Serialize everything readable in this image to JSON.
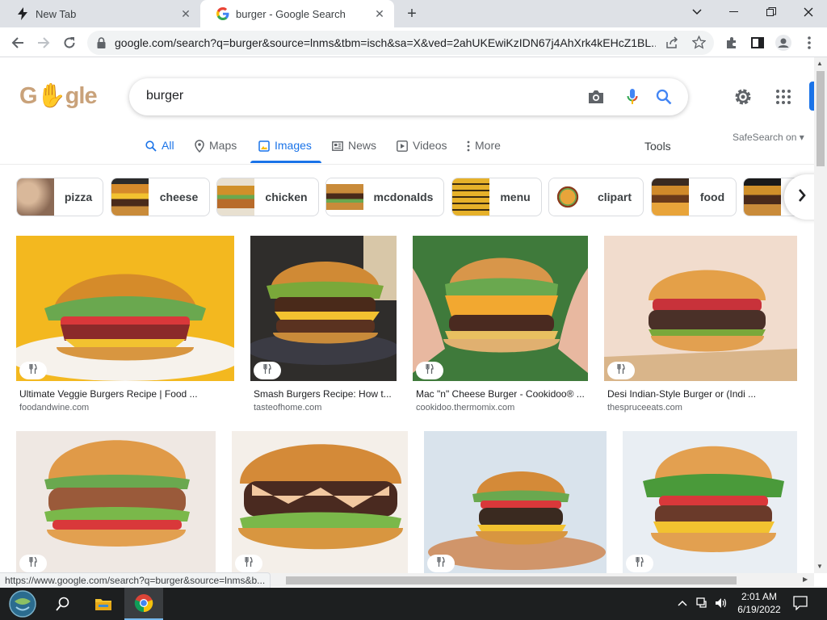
{
  "browser": {
    "tabs": [
      {
        "title": "New Tab"
      },
      {
        "title": "burger - Google Search"
      }
    ],
    "url": "google.com/search?q=burger&source=lnms&tbm=isch&sa=X&ved=2ahUKEwiKzIDN67j4AhXrk4kEHcZ1BL...",
    "status_url": "https://www.google.com/search?q=burger&source=lnms&b..."
  },
  "google": {
    "logo_text": "Google",
    "query": "burger",
    "safesearch": "SafeSearch on",
    "tools_label": "Tools",
    "nav_tabs": [
      {
        "label": "All",
        "icon": "search-icon"
      },
      {
        "label": "Maps",
        "icon": "map-pin-icon"
      },
      {
        "label": "Images",
        "icon": "image-icon",
        "active": true
      },
      {
        "label": "News",
        "icon": "news-icon"
      },
      {
        "label": "Videos",
        "icon": "play-icon"
      },
      {
        "label": "More",
        "icon": "more-vert-icon"
      }
    ],
    "chips": [
      {
        "label": "pizza",
        "color": "#b98a6a"
      },
      {
        "label": "cheese",
        "color": "#8b5a2b"
      },
      {
        "label": "chicken",
        "color": "#c58b3d"
      },
      {
        "label": "mcdonalds",
        "color": "#9a7a3a"
      },
      {
        "label": "menu",
        "color": "#e0b52a"
      },
      {
        "label": "clipart",
        "color": "#f0c070"
      },
      {
        "label": "food",
        "color": "#a0582a"
      },
      {
        "label": "",
        "color": "#6a4a2a"
      }
    ]
  },
  "results": [
    {
      "title": "Ultimate Veggie Burgers Recipe | Food ...",
      "source": "foodandwine.com",
      "bg": "#f2b51b"
    },
    {
      "title": "Smash Burgers Recipe: How t...",
      "source": "tasteofhome.com",
      "bg": "#3b3a38"
    },
    {
      "title": "Mac \"n\" Cheese Burger - Cookidoo® ...",
      "source": "cookidoo.thermomix.com",
      "bg": "#3e7a3a"
    },
    {
      "title": "Desi Indian-Style Burger or (Indi ...",
      "source": "thespruceeats.com",
      "bg": "#efd8c8"
    },
    {
      "title": "",
      "source": "",
      "bg": "#efe8e3"
    },
    {
      "title": "",
      "source": "",
      "bg": "#f3eee8"
    },
    {
      "title": "",
      "source": "",
      "bg": "#d8e2ec"
    },
    {
      "title": "",
      "source": "",
      "bg": "#e9eef4"
    }
  ],
  "taskbar": {
    "time": "2:01 AM",
    "date": "6/19/2022"
  }
}
